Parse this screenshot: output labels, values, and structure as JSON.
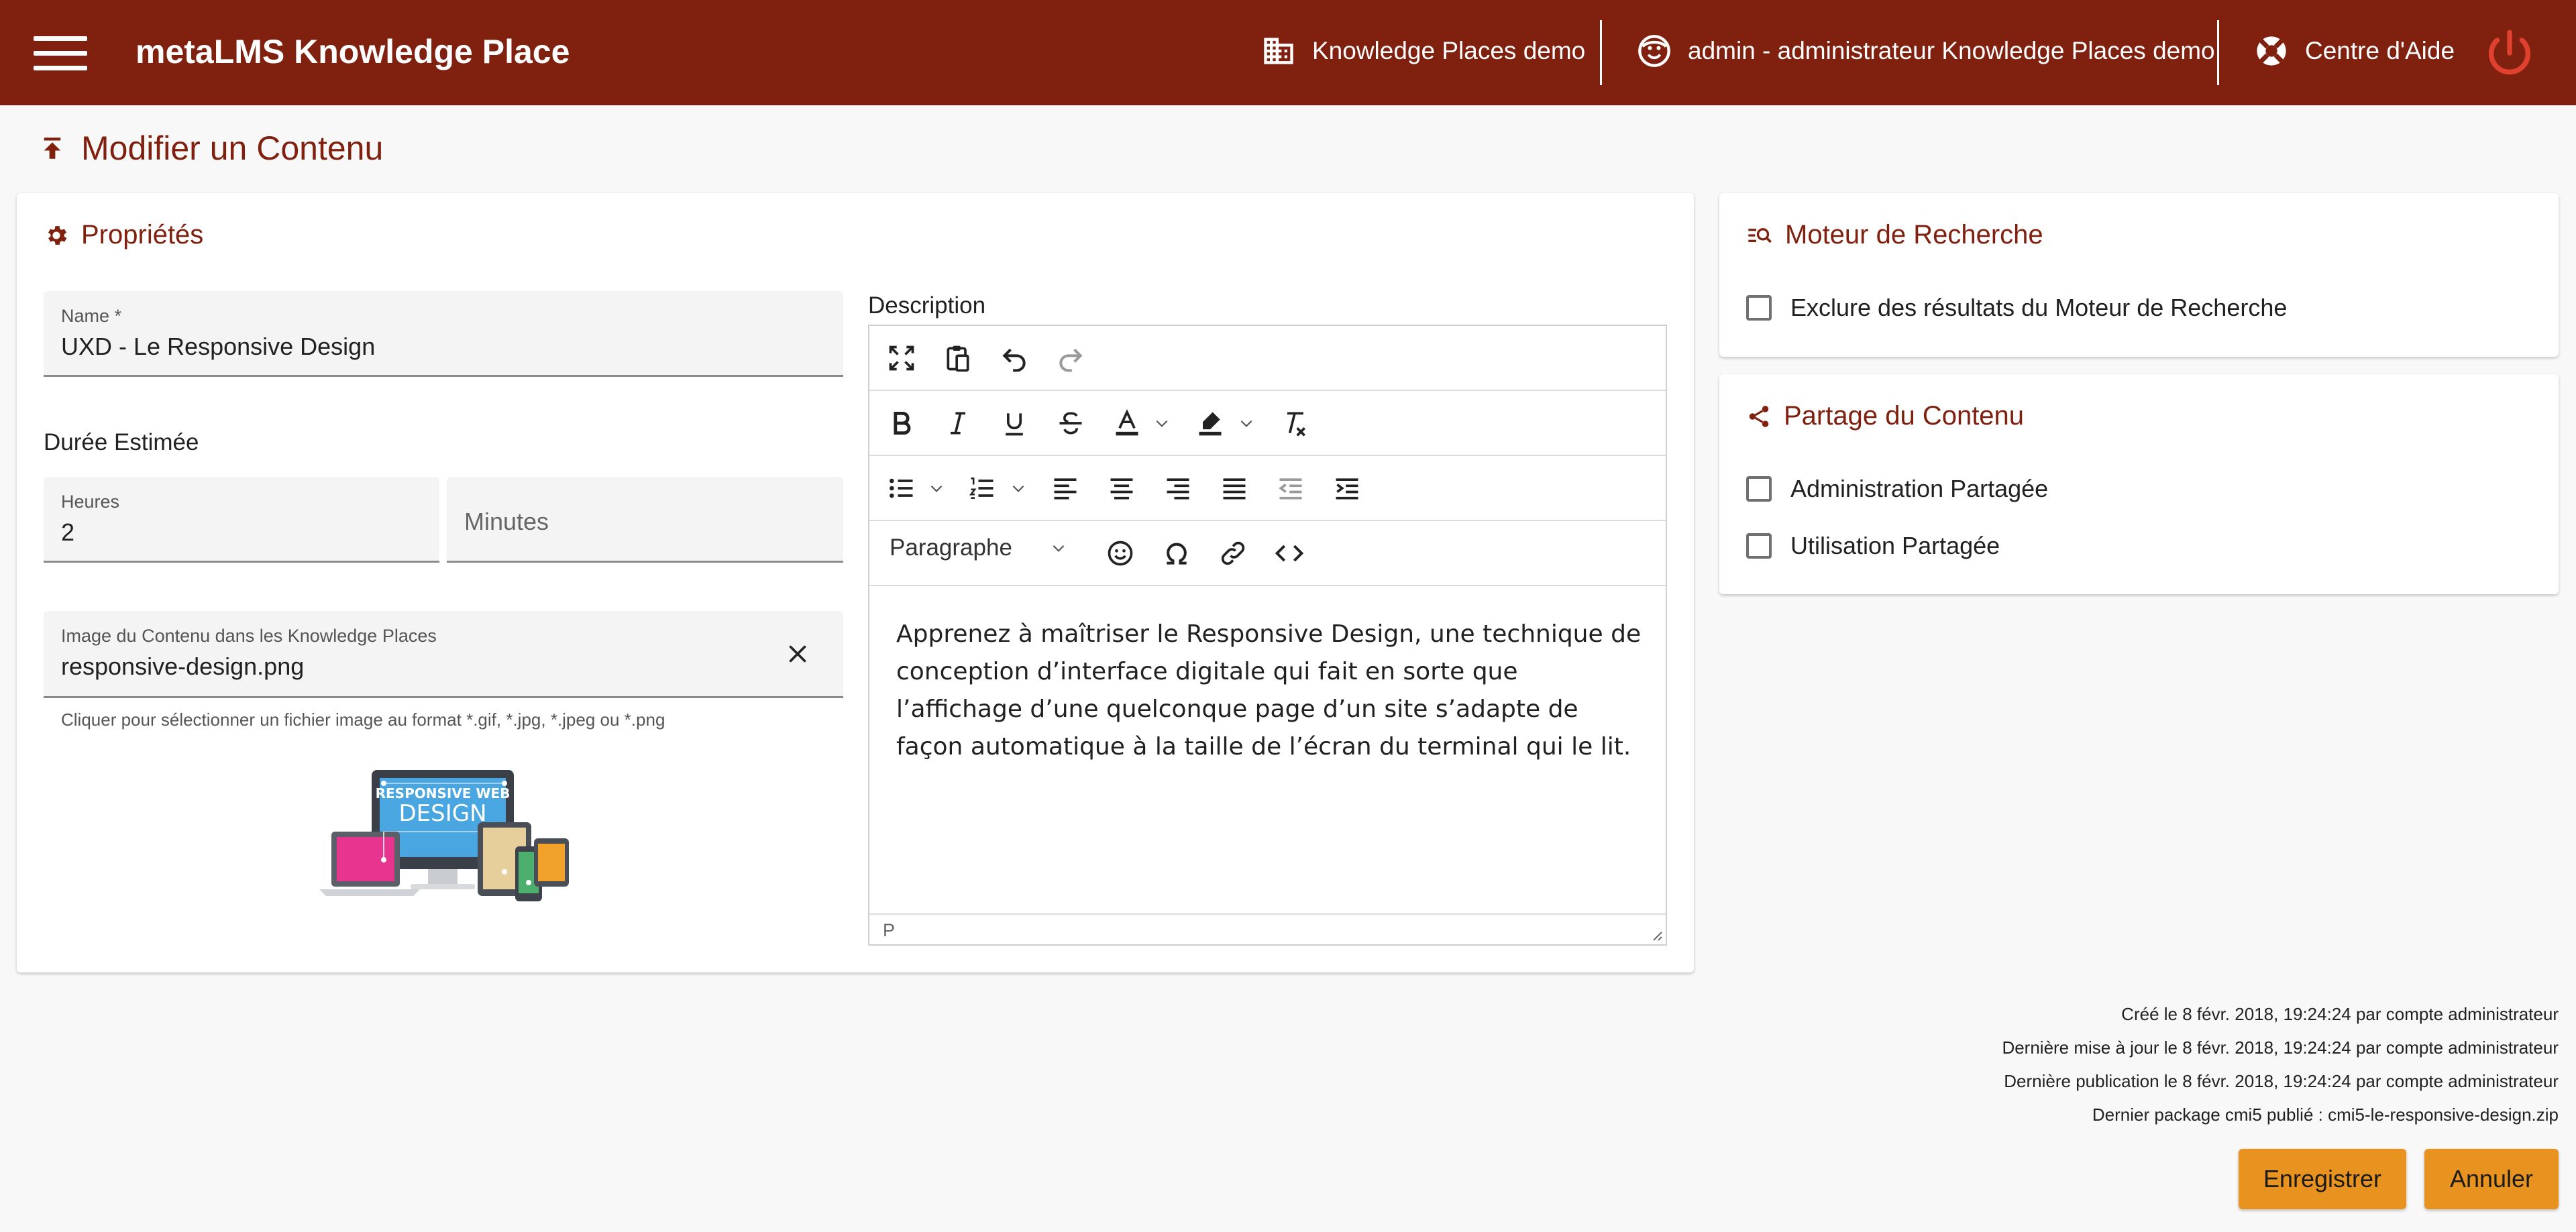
{
  "header": {
    "app_title": "metaLMS Knowledge Place",
    "place": "Knowledge Places demo",
    "user": "admin - administrateur Knowledge Places demo",
    "help": "Centre d'Aide",
    "accent": "#80200e"
  },
  "page": {
    "title": "Modifier un Contenu"
  },
  "properties": {
    "title": "Propriétés",
    "name_label": "Name *",
    "name_value": "UXD - Le Responsive Design",
    "duration_label": "Durée Estimée",
    "hours_label": "Heures",
    "hours_value": "2",
    "minutes_placeholder": "Minutes",
    "image_label": "Image du Contenu dans les Knowledge Places",
    "image_value": "responsive-design.png",
    "image_hint": "Cliquer pour sélectionner un fichier image au format *.gif, *.jpg, *.jpeg ou *.png",
    "thumbnail_text_1": "RESPONSIVE WEB",
    "thumbnail_text_2": "DESIGN"
  },
  "description": {
    "label": "Description",
    "block_format": "Paragraphe",
    "body": "Apprenez à maîtriser le Responsive Design, une technique de conception d’interface digitale qui fait en sorte que l’affichage d’une quelconque page d’un site s’adapte de façon automatique à la taille de l’écran du terminal qui le lit.",
    "status_path": "P"
  },
  "search_engine": {
    "title": "Moteur de Recherche",
    "exclude_label": "Exclure des résultats du Moteur de Recherche"
  },
  "sharing": {
    "title": "Partage du Contenu",
    "admin_label": "Administration Partagée",
    "usage_label": "Utilisation Partagée"
  },
  "meta": {
    "created": "Créé le 8 févr. 2018, 19:24:24 par compte administrateur",
    "updated": "Dernière mise à jour le 8 févr. 2018, 19:24:24 par compte administrateur",
    "published": "Dernière publication le 8 févr. 2018, 19:24:24 par compte administrateur",
    "package": "Dernier package cmi5 publié : cmi5-le-responsive-design.zip"
  },
  "actions": {
    "save": "Enregistrer",
    "cancel": "Annuler"
  }
}
